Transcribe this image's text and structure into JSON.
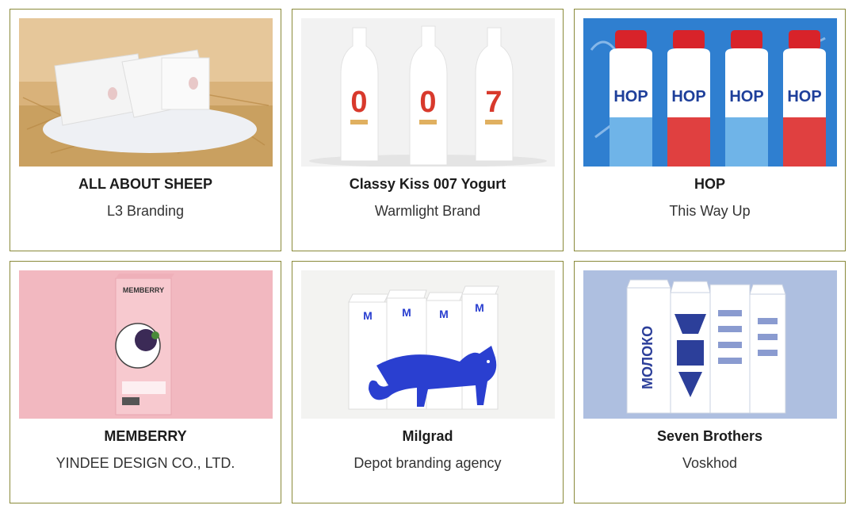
{
  "cards": [
    {
      "title": "ALL ABOUT SHEEP",
      "subtitle": "L3 Branding",
      "image": "sheep-packaging-image"
    },
    {
      "title": "Classy Kiss 007 Yogurt",
      "subtitle": "Warmlight Brand",
      "image": "yogurt-bottles-image",
      "bottle_labels": [
        "0",
        "0",
        "7"
      ]
    },
    {
      "title": "HOP",
      "subtitle": "This Way Up",
      "image": "hop-drinks-image",
      "label_text": "HOP"
    },
    {
      "title": "MEMBERRY",
      "subtitle": "YINDEE DESIGN CO., LTD.",
      "image": "memberry-carton-image",
      "brand_text": "MEMBERRY"
    },
    {
      "title": "Milgrad",
      "subtitle": "Depot branding agency",
      "image": "milgrad-cartons-image",
      "logo_text": "M"
    },
    {
      "title": "Seven Brothers",
      "subtitle": "Voskhod",
      "image": "seven-brothers-cartons-image",
      "carton_text": "МОЛОКО"
    }
  ],
  "colors": {
    "border": "#8a8a3a",
    "hop_blue": "#2f7fd0",
    "milgrad_blue": "#2a3fd0",
    "memberry_pink": "#f2b8c0"
  }
}
